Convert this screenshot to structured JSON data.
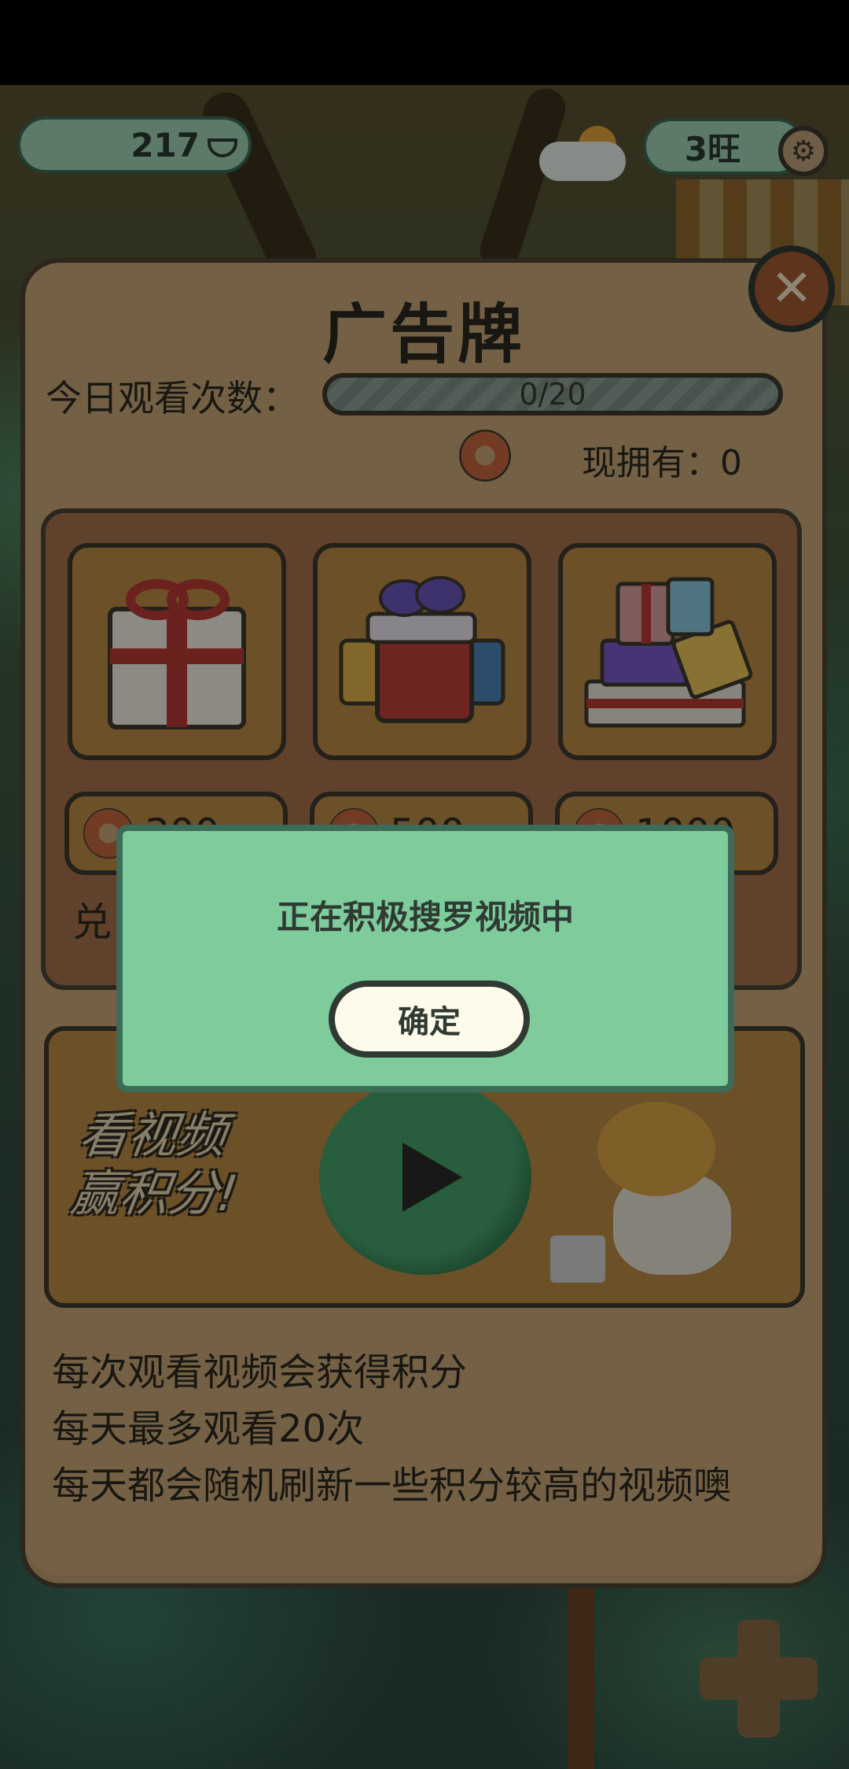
{
  "hud": {
    "coins": "217",
    "coin_icon": "gold-ingot-icon",
    "wang": "3旺",
    "settings_icon": "gear-icon",
    "weather_icon": "cloud-sun-icon"
  },
  "panel": {
    "title": "广告牌",
    "close_icon": "close-icon",
    "watch_count_label": "今日观看次数：",
    "progress_text": "0/20",
    "progress_fraction": 0.0,
    "owned_label": "现拥有：0",
    "currency_icon": "donut-icon"
  },
  "shop": {
    "items": [
      {
        "name": "white-gift-box",
        "price": "300"
      },
      {
        "name": "red-gift-box",
        "price": "500"
      },
      {
        "name": "gift-pile",
        "price": "1000"
      }
    ],
    "exchange_label": "兑"
  },
  "ad_banner": {
    "line1": "看视频",
    "line2": "赢积分!",
    "play_icon": "play-icon"
  },
  "rules": [
    "每次观看视频会获得积分",
    "每天最多观看20次",
    "每天都会随机刷新一些积分较高的视频噢"
  ],
  "modal": {
    "message": "正在积极搜罗视频中",
    "confirm_label": "确定"
  },
  "colors": {
    "panel_bg": "#c9a877",
    "modal_bg": "#7ecb9c",
    "button_bg": "#fffbea",
    "hud_pill": "#9fd3b2"
  }
}
